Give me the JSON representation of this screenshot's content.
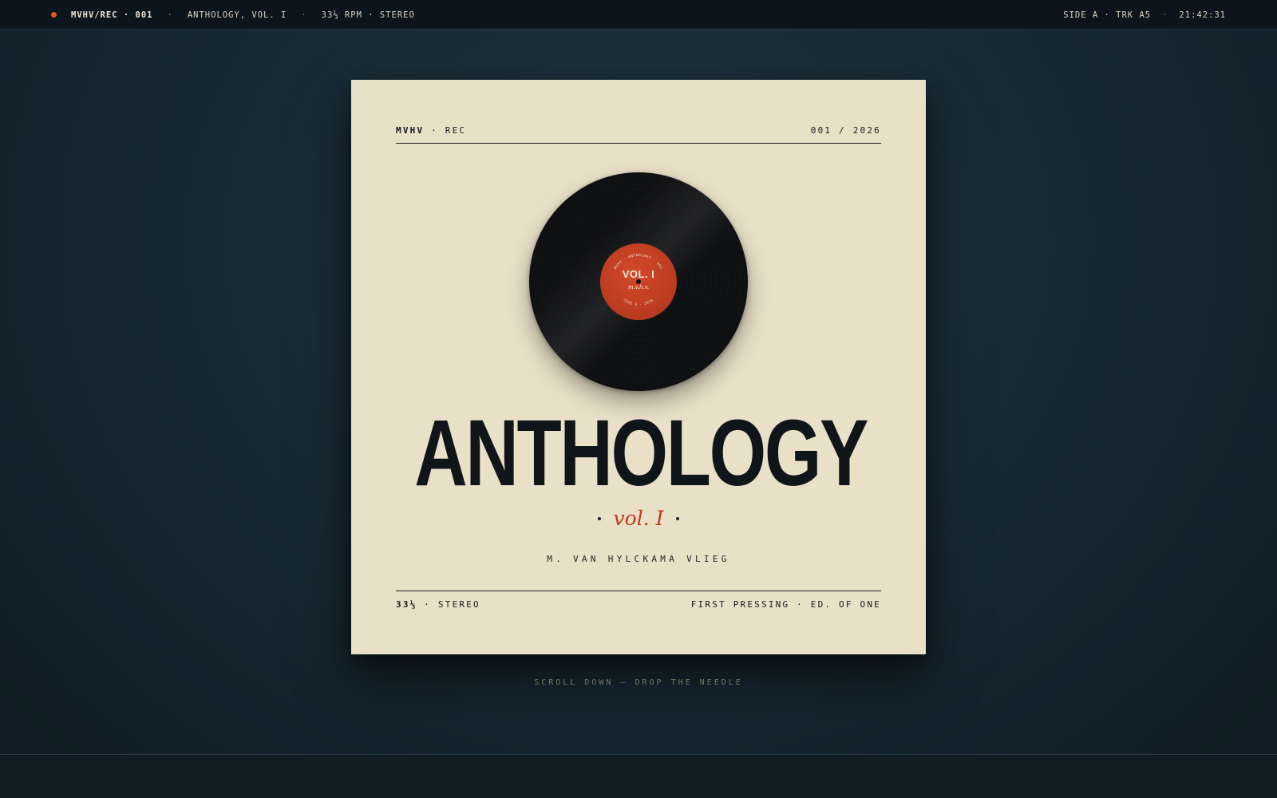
{
  "topbar": {
    "brand": "MVHV/REC · 001",
    "album": "ANTHOLOGY, VOL. I",
    "format": "33⅓ RPM · STEREO",
    "separator": "·",
    "side": "SIDE A · TRK A5",
    "time": "21:42:31"
  },
  "cover": {
    "label_brand": "MVHV",
    "label_rec": " · REC",
    "catalog": "001 / 2026",
    "title": "ANTHOLOGY",
    "volume": "vol. I",
    "artist": "M. VAN HYLCKAMA VLIEG",
    "speed": "33⅓",
    "speed_suffix": " · STEREO",
    "edition": "FIRST PRESSING · ED. OF ONE"
  },
  "record_label": {
    "title": "VOL. I",
    "subtitle": "m.v.h.v.",
    "arc_top": "MVHV · ANTHOLOGY · 001",
    "arc_bottom": "SIDE A · 2026"
  },
  "hint": {
    "scroll": "SCROLL DOWN — DROP THE NEEDLE"
  },
  "colors": {
    "accent": "#c2391e",
    "record_dot": "#e0552e",
    "cover_paper": "#e9e0c8"
  }
}
